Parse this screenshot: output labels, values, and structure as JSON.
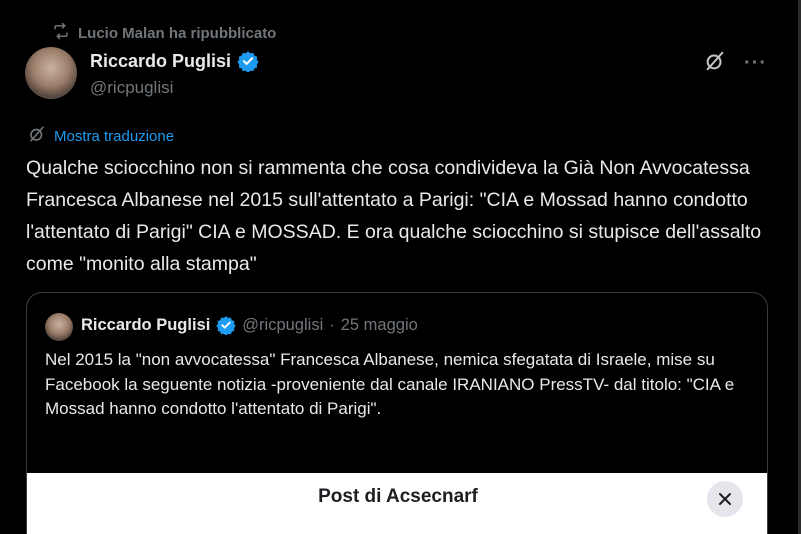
{
  "repost": {
    "label": "Lucio Malan ha ripubblicato"
  },
  "author": {
    "name": "Riccardo Puglisi",
    "handle": "@ricpuglisi"
  },
  "actions": {
    "more_label": "···"
  },
  "translate": {
    "label": "Mostra traduzione"
  },
  "tweet": {
    "text": "Qualche sciocchino non si rammenta che cosa condivideva la Già Non Avvocatessa Francesca Albanese nel 2015 sull'attentato a Parigi: \"CIA e Mossad hanno condotto l'attentato di Parigi\" CIA e MOSSAD. E ora qualche sciocchino si stupisce dell'assalto come \"monito alla stampa\""
  },
  "quote": {
    "name": "Riccardo Puglisi",
    "handle": "@ricpuglisi",
    "separator": "·",
    "date": "25 maggio",
    "text": "Nel 2015 la \"non avvocatessa\" Francesca Albanese, nemica sfegatata di Israele, mise su Facebook la seguente notizia -proveniente dal canale IRANIANO PressTV- dal titolo: \"CIA e Mossad hanno condotto l'attentato di Parigi\".",
    "media_title": "Post di Acsecnarf"
  },
  "colors": {
    "accent": "#1d9bf0",
    "muted": "#71767b",
    "text": "#e7e9ea",
    "background": "#000000"
  },
  "icons": [
    "repost-icon",
    "verified-icon",
    "grok-icon",
    "more-icon",
    "translate-icon",
    "close-icon"
  ]
}
